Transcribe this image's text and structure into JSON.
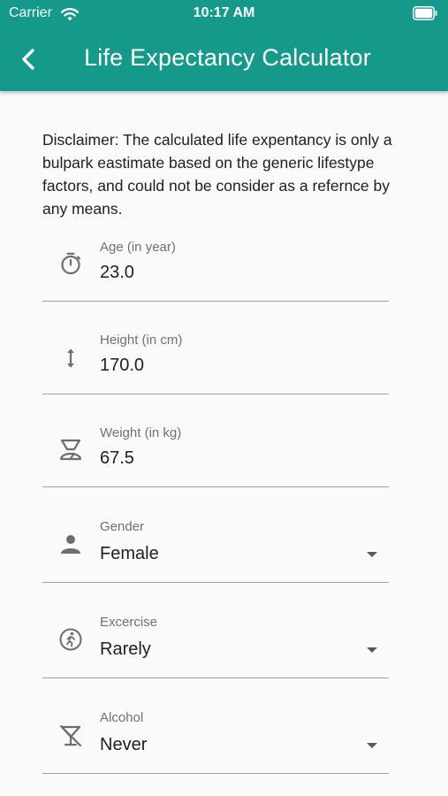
{
  "status_bar": {
    "carrier": "Carrier",
    "time": "10:17 AM"
  },
  "header": {
    "title": "Life Expectancy Calculator",
    "back_icon": "chevron-left-icon",
    "background_color": "#15998a"
  },
  "disclaimer": "Disclaimer: The calculated life expentancy is only a bulpark eastimate based on the generic lifestype factors, and could not be consider as a refernce by any means.",
  "fields": {
    "age": {
      "label": "Age (in year)",
      "value": "23.0",
      "icon": "timer-icon"
    },
    "height": {
      "label": "Height (in cm)",
      "value": "170.0",
      "icon": "vertical-arrows-icon"
    },
    "weight": {
      "label": "Weight (in kg)",
      "value": "67.5",
      "icon": "scale-icon"
    },
    "gender": {
      "label": "Gender",
      "value": "Female",
      "icon": "person-icon"
    },
    "exercise": {
      "label": "Excercise",
      "value": "Rarely",
      "icon": "running-icon"
    },
    "alcohol": {
      "label": "Alcohol",
      "value": "Never",
      "icon": "no-drinks-icon"
    }
  }
}
